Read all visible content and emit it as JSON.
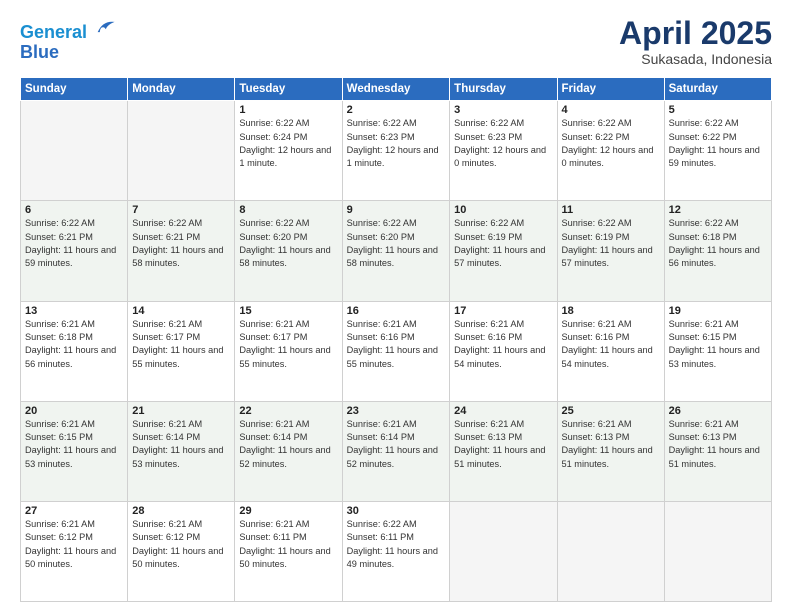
{
  "header": {
    "logo_line1": "General",
    "logo_line2": "Blue",
    "month": "April 2025",
    "location": "Sukasada, Indonesia"
  },
  "weekdays": [
    "Sunday",
    "Monday",
    "Tuesday",
    "Wednesday",
    "Thursday",
    "Friday",
    "Saturday"
  ],
  "weeks": [
    [
      {
        "day": null
      },
      {
        "day": null
      },
      {
        "day": "1",
        "sunrise": "Sunrise: 6:22 AM",
        "sunset": "Sunset: 6:24 PM",
        "daylight": "Daylight: 12 hours and 1 minute."
      },
      {
        "day": "2",
        "sunrise": "Sunrise: 6:22 AM",
        "sunset": "Sunset: 6:23 PM",
        "daylight": "Daylight: 12 hours and 1 minute."
      },
      {
        "day": "3",
        "sunrise": "Sunrise: 6:22 AM",
        "sunset": "Sunset: 6:23 PM",
        "daylight": "Daylight: 12 hours and 0 minutes."
      },
      {
        "day": "4",
        "sunrise": "Sunrise: 6:22 AM",
        "sunset": "Sunset: 6:22 PM",
        "daylight": "Daylight: 12 hours and 0 minutes."
      },
      {
        "day": "5",
        "sunrise": "Sunrise: 6:22 AM",
        "sunset": "Sunset: 6:22 PM",
        "daylight": "Daylight: 11 hours and 59 minutes."
      }
    ],
    [
      {
        "day": "6",
        "sunrise": "Sunrise: 6:22 AM",
        "sunset": "Sunset: 6:21 PM",
        "daylight": "Daylight: 11 hours and 59 minutes."
      },
      {
        "day": "7",
        "sunrise": "Sunrise: 6:22 AM",
        "sunset": "Sunset: 6:21 PM",
        "daylight": "Daylight: 11 hours and 58 minutes."
      },
      {
        "day": "8",
        "sunrise": "Sunrise: 6:22 AM",
        "sunset": "Sunset: 6:20 PM",
        "daylight": "Daylight: 11 hours and 58 minutes."
      },
      {
        "day": "9",
        "sunrise": "Sunrise: 6:22 AM",
        "sunset": "Sunset: 6:20 PM",
        "daylight": "Daylight: 11 hours and 58 minutes."
      },
      {
        "day": "10",
        "sunrise": "Sunrise: 6:22 AM",
        "sunset": "Sunset: 6:19 PM",
        "daylight": "Daylight: 11 hours and 57 minutes."
      },
      {
        "day": "11",
        "sunrise": "Sunrise: 6:22 AM",
        "sunset": "Sunset: 6:19 PM",
        "daylight": "Daylight: 11 hours and 57 minutes."
      },
      {
        "day": "12",
        "sunrise": "Sunrise: 6:22 AM",
        "sunset": "Sunset: 6:18 PM",
        "daylight": "Daylight: 11 hours and 56 minutes."
      }
    ],
    [
      {
        "day": "13",
        "sunrise": "Sunrise: 6:21 AM",
        "sunset": "Sunset: 6:18 PM",
        "daylight": "Daylight: 11 hours and 56 minutes."
      },
      {
        "day": "14",
        "sunrise": "Sunrise: 6:21 AM",
        "sunset": "Sunset: 6:17 PM",
        "daylight": "Daylight: 11 hours and 55 minutes."
      },
      {
        "day": "15",
        "sunrise": "Sunrise: 6:21 AM",
        "sunset": "Sunset: 6:17 PM",
        "daylight": "Daylight: 11 hours and 55 minutes."
      },
      {
        "day": "16",
        "sunrise": "Sunrise: 6:21 AM",
        "sunset": "Sunset: 6:16 PM",
        "daylight": "Daylight: 11 hours and 55 minutes."
      },
      {
        "day": "17",
        "sunrise": "Sunrise: 6:21 AM",
        "sunset": "Sunset: 6:16 PM",
        "daylight": "Daylight: 11 hours and 54 minutes."
      },
      {
        "day": "18",
        "sunrise": "Sunrise: 6:21 AM",
        "sunset": "Sunset: 6:16 PM",
        "daylight": "Daylight: 11 hours and 54 minutes."
      },
      {
        "day": "19",
        "sunrise": "Sunrise: 6:21 AM",
        "sunset": "Sunset: 6:15 PM",
        "daylight": "Daylight: 11 hours and 53 minutes."
      }
    ],
    [
      {
        "day": "20",
        "sunrise": "Sunrise: 6:21 AM",
        "sunset": "Sunset: 6:15 PM",
        "daylight": "Daylight: 11 hours and 53 minutes."
      },
      {
        "day": "21",
        "sunrise": "Sunrise: 6:21 AM",
        "sunset": "Sunset: 6:14 PM",
        "daylight": "Daylight: 11 hours and 53 minutes."
      },
      {
        "day": "22",
        "sunrise": "Sunrise: 6:21 AM",
        "sunset": "Sunset: 6:14 PM",
        "daylight": "Daylight: 11 hours and 52 minutes."
      },
      {
        "day": "23",
        "sunrise": "Sunrise: 6:21 AM",
        "sunset": "Sunset: 6:14 PM",
        "daylight": "Daylight: 11 hours and 52 minutes."
      },
      {
        "day": "24",
        "sunrise": "Sunrise: 6:21 AM",
        "sunset": "Sunset: 6:13 PM",
        "daylight": "Daylight: 11 hours and 51 minutes."
      },
      {
        "day": "25",
        "sunrise": "Sunrise: 6:21 AM",
        "sunset": "Sunset: 6:13 PM",
        "daylight": "Daylight: 11 hours and 51 minutes."
      },
      {
        "day": "26",
        "sunrise": "Sunrise: 6:21 AM",
        "sunset": "Sunset: 6:13 PM",
        "daylight": "Daylight: 11 hours and 51 minutes."
      }
    ],
    [
      {
        "day": "27",
        "sunrise": "Sunrise: 6:21 AM",
        "sunset": "Sunset: 6:12 PM",
        "daylight": "Daylight: 11 hours and 50 minutes."
      },
      {
        "day": "28",
        "sunrise": "Sunrise: 6:21 AM",
        "sunset": "Sunset: 6:12 PM",
        "daylight": "Daylight: 11 hours and 50 minutes."
      },
      {
        "day": "29",
        "sunrise": "Sunrise: 6:21 AM",
        "sunset": "Sunset: 6:11 PM",
        "daylight": "Daylight: 11 hours and 50 minutes."
      },
      {
        "day": "30",
        "sunrise": "Sunrise: 6:22 AM",
        "sunset": "Sunset: 6:11 PM",
        "daylight": "Daylight: 11 hours and 49 minutes."
      },
      {
        "day": null
      },
      {
        "day": null
      },
      {
        "day": null
      }
    ]
  ]
}
